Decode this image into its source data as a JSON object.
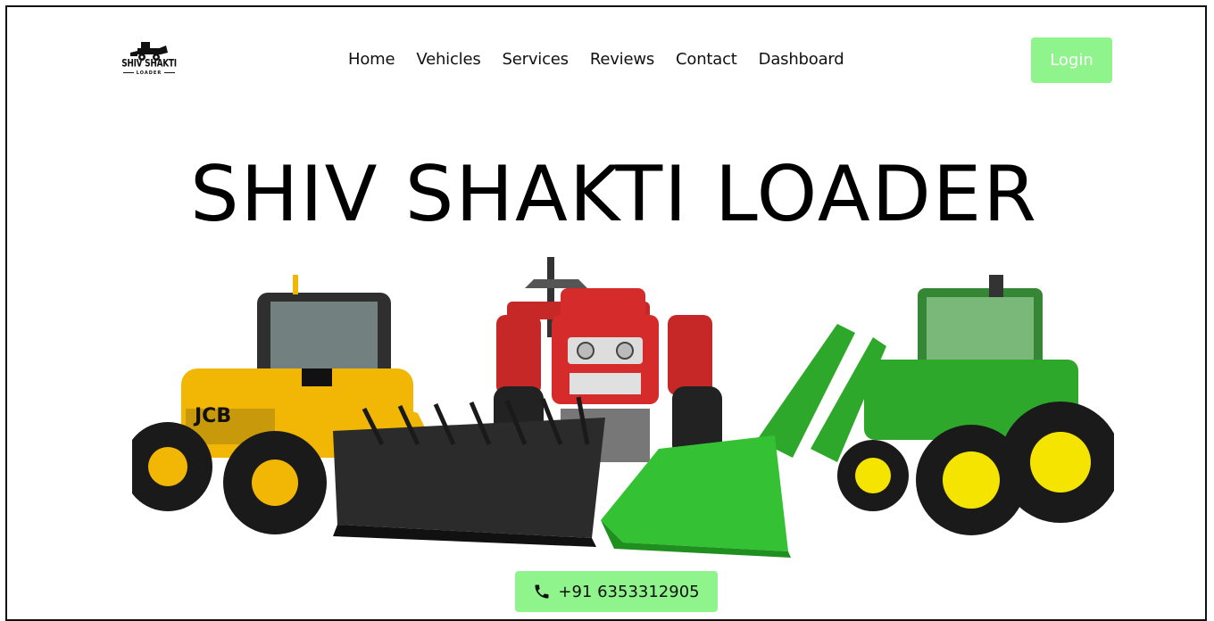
{
  "brand": {
    "logo_main": "SHIV SHAKTI",
    "logo_sub": "LOADER"
  },
  "nav": {
    "items": [
      "Home",
      "Vehicles",
      "Services",
      "Reviews",
      "Contact",
      "Dashboard"
    ]
  },
  "header": {
    "login_label": "Login"
  },
  "hero": {
    "title": "SHIV SHAKTI LOADER",
    "vehicles": [
      "yellow-telehandler-loader",
      "red-tractor",
      "green-tractor-loader"
    ],
    "phone_label": "+91 6353312905",
    "phone_icon": "phone-icon"
  },
  "colors": {
    "accent": "#90f48c",
    "text": "#111111",
    "yellow": "#f2b705",
    "red": "#d62b2b",
    "green": "#2ea82a"
  }
}
